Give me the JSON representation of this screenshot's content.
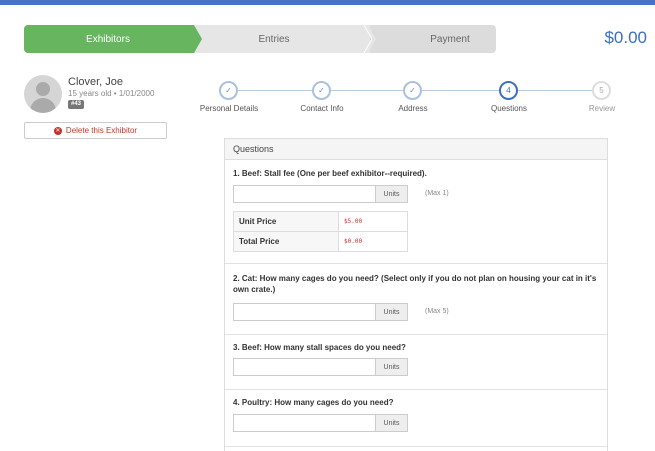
{
  "wizard": {
    "steps": [
      "Exhibitors",
      "Entries",
      "Payment"
    ],
    "total": "$0.00"
  },
  "exhibitor": {
    "name": "Clover, Joe",
    "age_dob": "15 years old • 1/01/2000",
    "badge": "#43",
    "delete_label": "Delete this Exhibitor"
  },
  "progress": {
    "steps": [
      {
        "label": "Personal Details",
        "mark": "✓",
        "state": "done"
      },
      {
        "label": "Contact Info",
        "mark": "✓",
        "state": "done"
      },
      {
        "label": "Address",
        "mark": "✓",
        "state": "done"
      },
      {
        "label": "Questions",
        "mark": "4",
        "state": "active"
      },
      {
        "label": "Review",
        "mark": "5",
        "state": "pending"
      }
    ]
  },
  "questions": {
    "header": "Questions",
    "items": [
      {
        "text": "1. Beef: Stall fee (One per beef exhibitor--required).",
        "units": "Units",
        "max": "(Max 1)"
      },
      {
        "text": "2. Cat: How many cages do you need? (Select only if you do not plan on housing your cat in it's own crate.)",
        "units": "Units",
        "max": "(Max 5)"
      },
      {
        "text": "3. Beef: How many stall spaces do you need?",
        "units": "Units",
        "max": ""
      },
      {
        "text": "4. Poultry: How many cages do you need?",
        "units": "Units",
        "max": ""
      }
    ],
    "price": {
      "unit_label": "Unit Price",
      "unit_value": "$5.00",
      "total_label": "Total Price",
      "total_value": "$0.00"
    }
  },
  "colors": {
    "accent": "#3a6fc1",
    "done_green": "#67b65f",
    "topbar": "#4a72c4"
  }
}
